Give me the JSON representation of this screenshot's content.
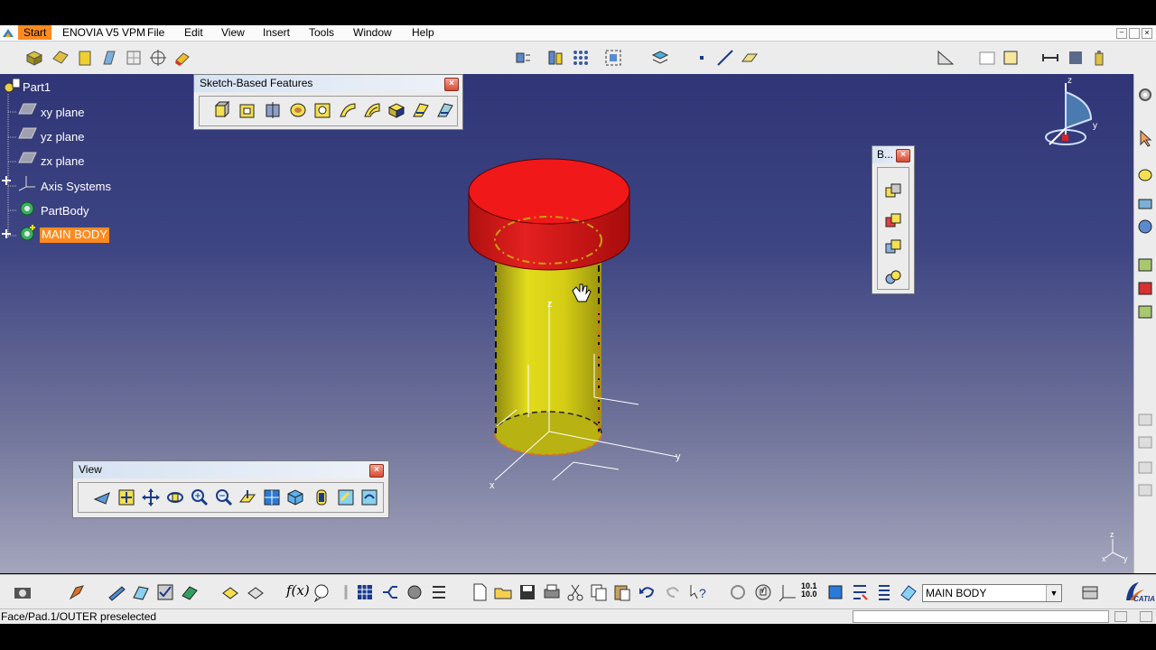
{
  "menubar": {
    "start": "Start",
    "items": [
      "ENOVIA V5 VPM",
      "File",
      "Edit",
      "View",
      "Insert",
      "Tools",
      "Window",
      "Help"
    ]
  },
  "tree": {
    "root": "Part1",
    "items": [
      "xy plane",
      "yz plane",
      "zx plane",
      "Axis Systems",
      "PartBody",
      "MAIN BODY"
    ],
    "selected_index": 5
  },
  "panels": {
    "sketch_features": {
      "title": "Sketch-Based Features"
    },
    "view": {
      "title": "View"
    },
    "boolean": {
      "title": "B..."
    }
  },
  "compass": {
    "x_label": "x",
    "y_label": "y",
    "z_label": "z"
  },
  "axes": {
    "x": "x",
    "y": "y",
    "z": "z"
  },
  "toolbar": {
    "current_body": "MAIN BODY"
  },
  "status": {
    "text": "Face/Pad.1/OUTER preselected"
  },
  "brand": "CATIA",
  "colors": {
    "head": "#e81818",
    "shaft": "#d6cf12",
    "highlight_selected": "#ff8a1f",
    "viewport_top": "#2f3576"
  }
}
